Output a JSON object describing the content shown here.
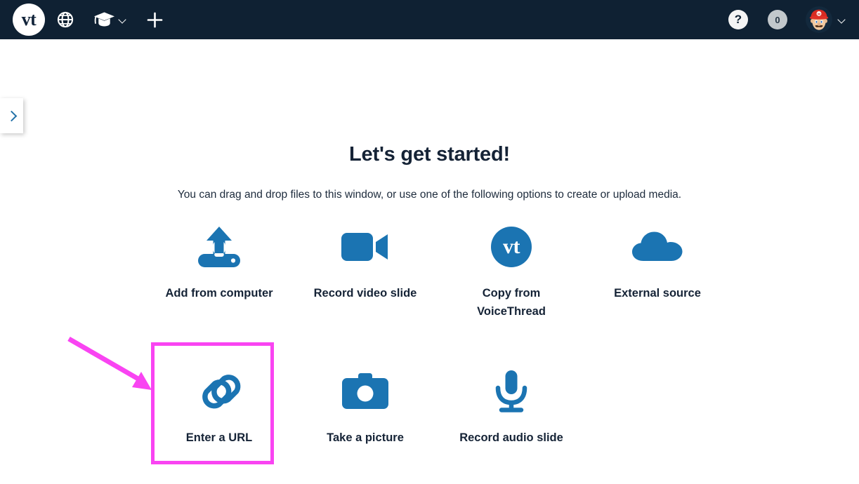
{
  "header": {
    "logo_text": "vt",
    "logo_name": "voicethread-logo",
    "globe_icon": "globe-icon",
    "cap_icon": "graduation-cap-icon",
    "cap_chevron_icon": "chevron-down-icon",
    "plus_icon": "plus-icon",
    "help_label": "?",
    "notification_count": "0",
    "avatar_icon": "user-avatar-mario",
    "avatar_chevron_icon": "chevron-down-icon",
    "background_color": "#0f2133"
  },
  "sidebar_toggle": {
    "name": "expand-sidebar-tab",
    "icon": "chevron-right-icon",
    "icon_color": "#2372a8"
  },
  "main": {
    "title": "Let's get started!",
    "subtitle": "You can drag and drop files to this window, or use one of the following options to create or upload media.",
    "accent_color": "#1b74b2",
    "text_color": "#152336"
  },
  "options": {
    "row1": [
      {
        "label": "Add from computer",
        "icon": "upload-to-drive-icon"
      },
      {
        "label": "Record video slide",
        "icon": "video-camera-icon"
      },
      {
        "label": "Copy from VoiceThread",
        "icon": "voicethread-vt-icon",
        "badge_text": "vt"
      },
      {
        "label": "External source",
        "icon": "cloud-icon"
      }
    ],
    "row2": [
      {
        "label": "Enter a URL",
        "icon": "link-chain-icon"
      },
      {
        "label": "Take a picture",
        "icon": "camera-icon"
      },
      {
        "label": "Record audio slide",
        "icon": "microphone-icon"
      }
    ]
  },
  "annotation": {
    "highlight_name": "enter-a-url-highlight",
    "highlight_color": "#f944f2",
    "arrow_name": "pink-pointer-arrow",
    "arrow_color": "#f944f2"
  }
}
